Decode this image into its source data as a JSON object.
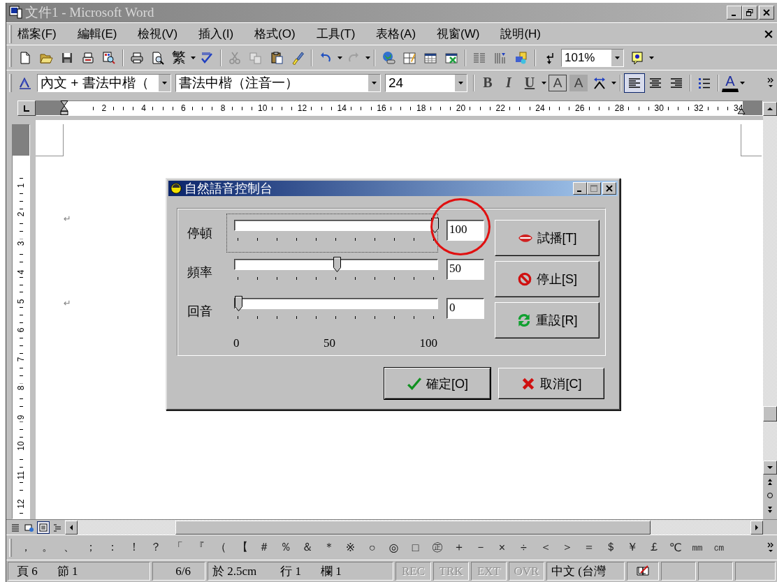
{
  "window": {
    "title": "文件1 - Microsoft Word"
  },
  "menu_bar": [
    "檔案(F)",
    "編輯(E)",
    "檢視(V)",
    "插入(I)",
    "格式(O)",
    "工具(T)",
    "表格(A)",
    "視窗(W)",
    "說明(H)"
  ],
  "standard_toolbar": {
    "conversion_label": "繁",
    "zoom": "101%"
  },
  "formatting_toolbar": {
    "style": "內文 + 書法中楷（",
    "font": "書法中楷（注音一）",
    "size": "24",
    "text_buttons": [
      {
        "label": "B",
        "kind": "bold"
      },
      {
        "label": "I",
        "kind": "italic"
      },
      {
        "label": "U",
        "kind": "underline"
      },
      {
        "label": "A",
        "kind": "border"
      },
      {
        "label": "A",
        "kind": "shading"
      }
    ],
    "alignment": [
      {
        "selected": true
      },
      {
        "selected": false
      },
      {
        "selected": false
      }
    ],
    "font_color": "A"
  },
  "horizontal_ruler": [
    "2",
    "4",
    "6",
    "8",
    "10",
    "12",
    "14",
    "16",
    "18",
    "20",
    "22",
    "24",
    "26",
    "28",
    "30",
    "32",
    "34"
  ],
  "vertical_ruler": [
    "1",
    "2",
    "3",
    "4",
    "5",
    "6",
    "7",
    "8",
    "9",
    "10",
    "11",
    "12"
  ],
  "document": {
    "paragraph_marks": [
      "↵",
      "↵"
    ]
  },
  "dialog": {
    "title": "自然語音控制台",
    "sliders": [
      {
        "label": "停頓",
        "level": 1,
        "value": "100",
        "focused": true,
        "circled": true
      },
      {
        "label": "頻率",
        "level": 0.5,
        "value": "50",
        "focused": false,
        "circled": false
      },
      {
        "label": "回音",
        "level": 0,
        "value": "0",
        "focused": false,
        "circled": false
      }
    ],
    "scale_labels": [
      "0",
      "50",
      "100"
    ],
    "side_buttons": [
      {
        "label": "試播[T]",
        "kind": "play"
      },
      {
        "label": "停止[S]",
        "kind": "stop"
      },
      {
        "label": "重設[R]",
        "kind": "reset"
      }
    ],
    "buttons": [
      {
        "label": "確定[O]",
        "kind": "ok",
        "default": true
      },
      {
        "label": "取消[C]",
        "kind": "cancel",
        "default": false
      }
    ]
  },
  "view_buttons": [
    {
      "selected": false
    },
    {
      "selected": false
    },
    {
      "selected": true
    },
    {
      "selected": false
    }
  ],
  "symbol_toolbar": [
    "，",
    "。",
    "、",
    "；",
    "：",
    "！",
    "？",
    "「",
    "『",
    "（",
    "【",
    "＃",
    "％",
    "＆",
    "＊",
    "※",
    "○",
    "◎",
    "□",
    "㊣",
    "＋",
    "－",
    "×",
    "÷",
    "＜",
    "＞",
    "＝",
    "＄",
    "￥",
    "￡",
    "℃",
    "㎜",
    "㎝"
  ],
  "status_bar": {
    "page": "頁 6",
    "section": "節 1",
    "pages": "6/6",
    "at": "於 2.5cm",
    "line": "行 1",
    "column": "欄 1",
    "modes": [
      {
        "label": "REC",
        "active": false
      },
      {
        "label": "TRK",
        "active": false
      },
      {
        "label": "EXT",
        "active": false
      },
      {
        "label": "OVR",
        "active": false
      }
    ],
    "language": "中文 (台灣"
  }
}
